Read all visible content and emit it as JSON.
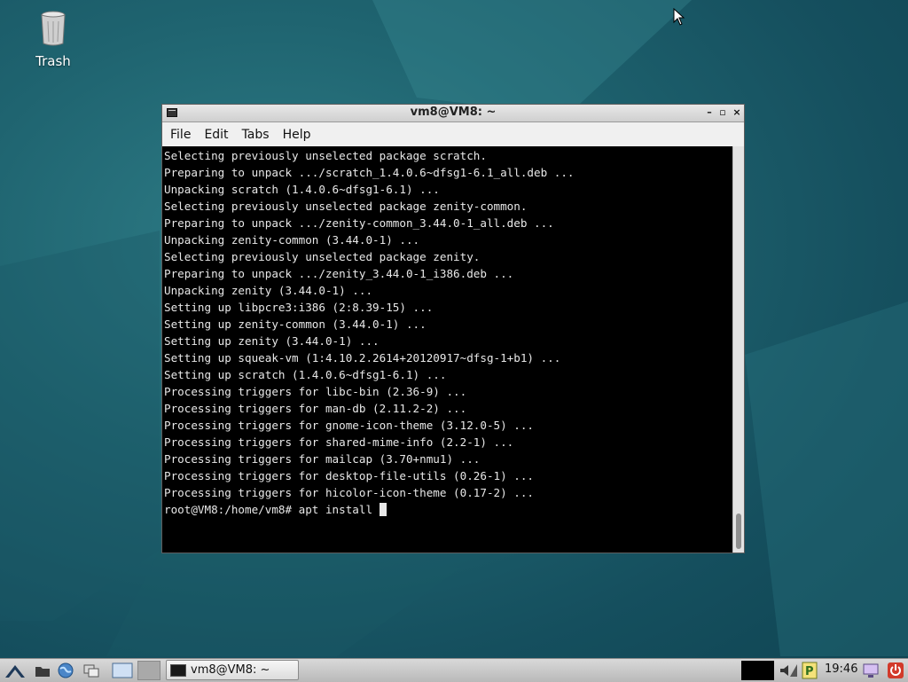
{
  "desktop": {
    "trash_label": "Trash"
  },
  "window": {
    "title": "vm8@VM8: ~",
    "menu": [
      "File",
      "Edit",
      "Tabs",
      "Help"
    ]
  },
  "terminal": {
    "lines": [
      "Selecting previously unselected package scratch.",
      "Preparing to unpack .../scratch_1.4.0.6~dfsg1-6.1_all.deb ...",
      "Unpacking scratch (1.4.0.6~dfsg1-6.1) ...",
      "Selecting previously unselected package zenity-common.",
      "Preparing to unpack .../zenity-common_3.44.0-1_all.deb ...",
      "Unpacking zenity-common (3.44.0-1) ...",
      "Selecting previously unselected package zenity.",
      "Preparing to unpack .../zenity_3.44.0-1_i386.deb ...",
      "Unpacking zenity (3.44.0-1) ...",
      "Setting up libpcre3:i386 (2:8.39-15) ...",
      "Setting up zenity-common (3.44.0-1) ...",
      "Setting up zenity (3.44.0-1) ...",
      "Setting up squeak-vm (1:4.10.2.2614+20120917~dfsg-1+b1) ...",
      "Setting up scratch (1.4.0.6~dfsg1-6.1) ...",
      "Processing triggers for libc-bin (2.36-9) ...",
      "Processing triggers for man-db (2.11.2-2) ...",
      "Processing triggers for gnome-icon-theme (3.12.0-5) ...",
      "Processing triggers for shared-mime-info (2.2-1) ...",
      "Processing triggers for mailcap (3.70+nmu1) ...",
      "Processing triggers for desktop-file-utils (0.26-1) ...",
      "Processing triggers for hicolor-icon-theme (0.17-2) ..."
    ],
    "prompt": "root@VM8:/home/vm8# apt install "
  },
  "taskbar": {
    "task_label": "vm8@VM8: ~",
    "clock": "19:46"
  }
}
